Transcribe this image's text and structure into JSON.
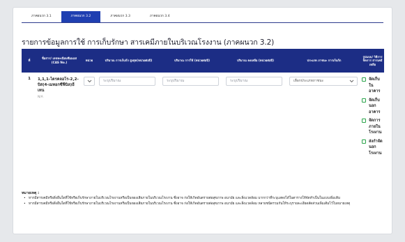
{
  "tabs": [
    "ภาคผนวก 3.1",
    "ภาคผนวก 3.2",
    "ภาคผนวก 3.3",
    "ภาคผนวก 3.4"
  ],
  "active_tab_index": 1,
  "title": "รายการข้อมูลการใช้ การเก็บรักษา สารเคมีภายในบริเวณโรงงาน (ภาคผนวก 3.2)",
  "table": {
    "headers": {
      "index": "ที่",
      "chemical": "ชื่อสาร/ เลขทะเบียนซีเอเอส (CAS No.)",
      "unit": "หน่วย",
      "storage": "ปริมาณ การเก็บกัก สูงสุด(หน่วยต่อปี)",
      "usage": "ปริมาณ การใช้ (หน่วยต่อปี)",
      "remaining": "ปริมาณ คงเหลือ (หน่วยต่อปี)",
      "type": "ประเภท ภาชนะ การเก็บกัก",
      "method": "รูปแบบ/ วิธีการจัดการ สารเคมีเหลือ"
    },
    "rows": [
      {
        "index": "1",
        "chemical": "1,1,1-ไตรคลอโร-2,2-บิส(4-เมทอกซีฟีนิล)อีเทน",
        "note": "N/A",
        "storage_placeholder": "ระบุปริมาณ",
        "usage_placeholder": "ระบุปริมาณ",
        "remaining_placeholder": "ระบุปริมาณ",
        "type_value": "เลือกประเภทภาชนะ",
        "methods": [
          "จัดเก็บในอาคาร",
          "จัดเก็บนอกอาคาร",
          "จัดการภายในโรงงาน",
          "ส่งกำจัดนอกโรงงาน"
        ]
      }
    ]
  },
  "notes": {
    "heading": "หมายเหตุ :",
    "items": [
      "หากมีสารเคมีหรือสิ่งอื่นใดที่ใช้หรือเก็บรักษาภายในบริเวณโรงงานหรือเป็นของเสียภายในบริเวณโรงงาน ซึ่งอาจ ก่อให้เกิดอันตรายต่อสุขภาพ อนามัย และสิ่งแวดล้อม มากกว่าที่ระบุแสดงได้ในตารางให้จัดทำเป็นในแบบเพิ่มเติม",
      "หากมีสารเคมีหรือสิ่งอื่นใดที่ใช้หรือเก็บรักษาภายในบริเวณโรงงานหรือเป็นของเสียภายในบริเวณโรงงาน ซึ่งอาจ ก่อให้เกิดอันตรายต่อสุขภาพ อนามัย และสิ่งแวดล้อม หลายชนิดรวมกันให้ระบุรายละเอียดสัดส่วนเพิ่มเติมไว้ในหมายเหตุ"
    ]
  },
  "colors": {
    "header_bg": "#1c2d85",
    "active_tab": "#1f3fb1",
    "checkbox": "#2aa44a"
  }
}
